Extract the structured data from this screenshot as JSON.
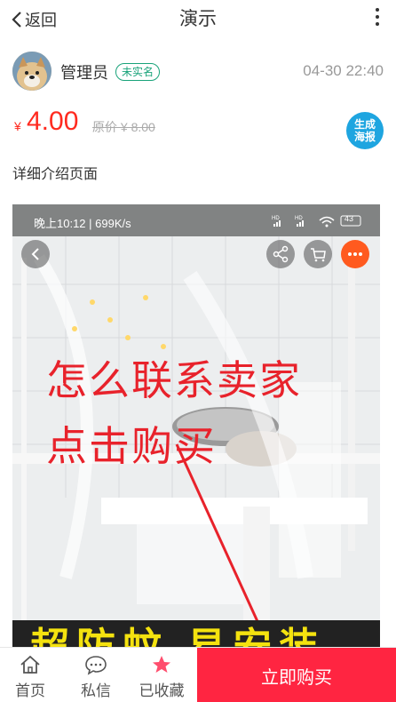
{
  "header": {
    "back_label": "返回",
    "title": "演示",
    "more_icon": "more-vertical-icon"
  },
  "author": {
    "name": "管理员",
    "badge": "未实名",
    "time": "04-30 22:40"
  },
  "price": {
    "currency": "¥",
    "value": "4.00",
    "original": "原价 ¥ 8.00",
    "poster_label_1": "生成",
    "poster_label_2": "海报"
  },
  "description": "详细介绍页面",
  "photo": {
    "status_time": "晚上10:12 | 699K/s",
    "status_battery": "43",
    "overlay_line1": "怎么联系卖家",
    "overlay_line2": "点击购买",
    "banner_text": "超防蚊 易安装"
  },
  "bottom": {
    "home_label": "首页",
    "message_label": "私信",
    "favorite_label": "已收藏",
    "buy_label": "立即购买"
  },
  "colors": {
    "accent_red": "#ff2541",
    "price_red": "#ff2a1f",
    "badge_green": "#19a37a",
    "poster_blue": "#1ea5e0"
  }
}
